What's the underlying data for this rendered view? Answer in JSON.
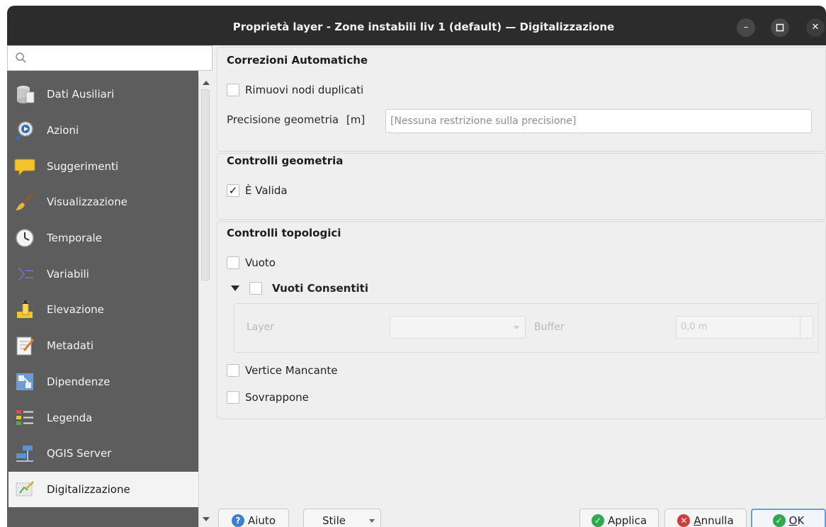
{
  "window": {
    "title": "Proprietà layer - Zone instabili liv 1 (default) — Digitalizzazione",
    "controls": {
      "minimize": "–",
      "maximize": "▢",
      "close": "✕"
    }
  },
  "sidebar": {
    "search_placeholder": "",
    "items": [
      {
        "label": "Dati Ausiliari",
        "icon": "database-icon"
      },
      {
        "label": "Azioni",
        "icon": "gear-icon"
      },
      {
        "label": "Suggerimenti",
        "icon": "speech-bubble-icon"
      },
      {
        "label": "Visualizzazione",
        "icon": "paintbrush-icon"
      },
      {
        "label": "Temporale",
        "icon": "clock-icon"
      },
      {
        "label": "Variabili",
        "icon": "variables-icon"
      },
      {
        "label": "Elevazione",
        "icon": "elevation-icon"
      },
      {
        "label": "Metadati",
        "icon": "metadata-icon"
      },
      {
        "label": "Dipendenze",
        "icon": "dependencies-icon"
      },
      {
        "label": "Legenda",
        "icon": "legend-icon"
      },
      {
        "label": "QGIS Server",
        "icon": "server-icon"
      },
      {
        "label": "Digitalizzazione",
        "icon": "digitizing-icon",
        "active": true
      }
    ]
  },
  "corrections": {
    "title": "Correzioni Automatiche",
    "remove_duplicates": {
      "label": "Rimuovi nodi duplicati",
      "checked": false
    },
    "precision_label": "Precisione geometria",
    "precision_unit": "[m]",
    "precision_placeholder": "[Nessuna restrizione sulla precisione]"
  },
  "geometry_checks": {
    "title": "Controlli geometria",
    "is_valid": {
      "label": "È Valida",
      "checked": true,
      "mark": "✓"
    }
  },
  "topology_checks": {
    "title": "Controlli topologici",
    "empty": {
      "label": "Vuoto",
      "checked": false
    },
    "allowed_gaps": {
      "label": "Vuoti Consentiti",
      "checked": false,
      "layer_label": "Layer",
      "buffer_label": "Buffer",
      "buffer_value": "0,0 m"
    },
    "missing_vertex": {
      "label": "Vertice Mancante",
      "checked": false
    },
    "overlaps": {
      "label": "Sovrappone",
      "checked": false
    }
  },
  "buttons": {
    "help": "Aiuto",
    "style": "Stile",
    "apply": "Applica",
    "cancel_first": "A",
    "cancel_rest": "nnulla",
    "ok_first": "O",
    "ok_rest": "K"
  },
  "colors": {
    "titlebar": "#2c2c2c",
    "sidebar": "#5d5d5d",
    "apply_icon": "#2fa84f",
    "cancel_icon": "#d43b3b",
    "help_icon": "#3d7fd1",
    "ok_border": "#6a9fd4"
  }
}
